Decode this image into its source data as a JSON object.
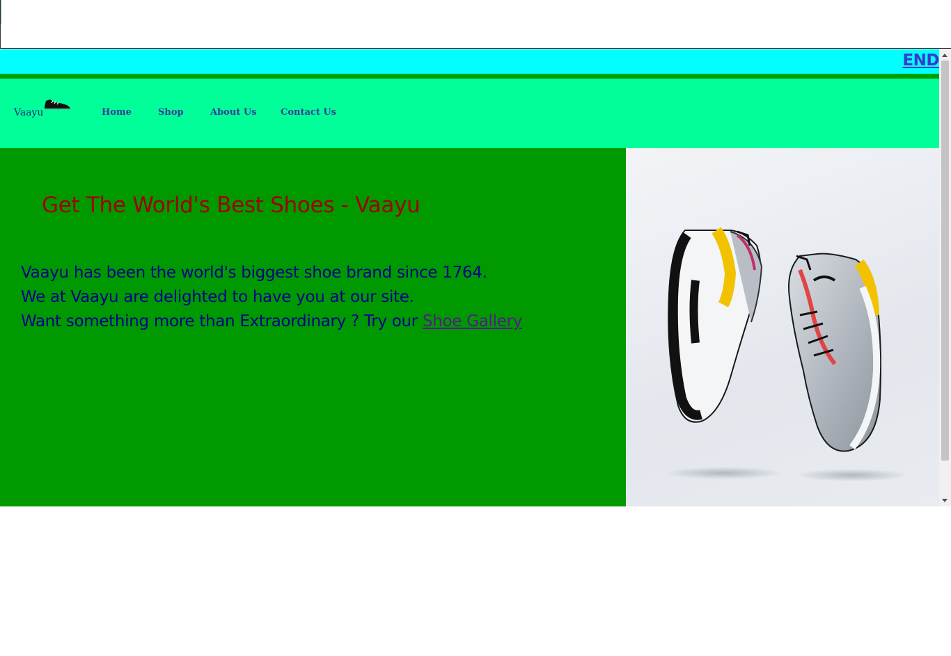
{
  "marquee": {
    "text": "END"
  },
  "nav": {
    "brand": "Vaayu",
    "links": [
      "Home",
      "Shop",
      "About Us",
      "Contact Us"
    ]
  },
  "hero": {
    "title": "Get The World's Best Shoes - Vaayu",
    "lines": [
      "Vaayu has been the world's biggest shoe brand since 1764.",
      "We at Vaayu are delighted to have you at our site.",
      "Want something more than Extraordinary ? Try our "
    ],
    "link_label": "Shoe Gallery"
  },
  "colors": {
    "marquee_bg": "#00ffff",
    "nav_bg": "#00ff99",
    "hero_bg": "#009900",
    "title": "#a00000",
    "body_text": "#00008b"
  }
}
